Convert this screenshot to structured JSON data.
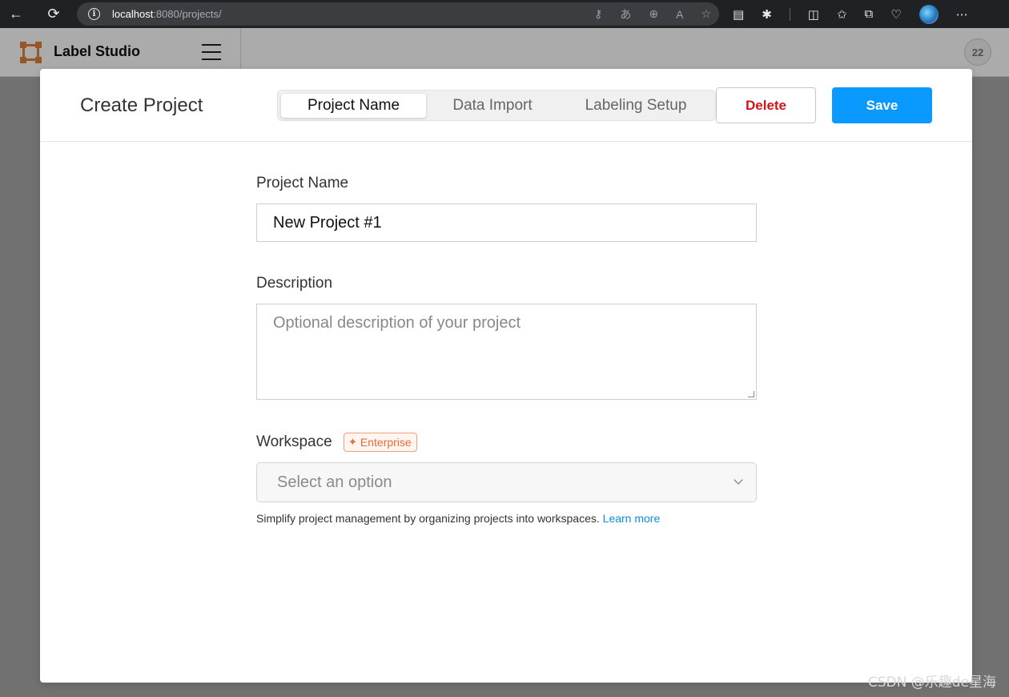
{
  "browser": {
    "url_host": "localhost",
    "url_path": ":8080/projects/",
    "icons": [
      "back-icon",
      "refresh-icon",
      "info-icon",
      "key-icon",
      "translate-icon",
      "zoom-icon",
      "read-aloud-icon",
      "favorite-icon",
      "reading-view-icon",
      "extensions-icon",
      "split-screen-icon",
      "favorites-icon",
      "collections-icon",
      "health-icon",
      "profile-avatar",
      "more-icon"
    ]
  },
  "app": {
    "title": "Label Studio",
    "user_initials": "22"
  },
  "modal": {
    "title": "Create Project",
    "tabs": [
      {
        "label": "Project Name",
        "active": true
      },
      {
        "label": "Data Import",
        "active": false
      },
      {
        "label": "Labeling Setup",
        "active": false
      }
    ],
    "delete_label": "Delete",
    "save_label": "Save",
    "project_name": {
      "label": "Project Name",
      "value": "New Project #1"
    },
    "description": {
      "label": "Description",
      "placeholder": "Optional description of your project"
    },
    "workspace": {
      "label": "Workspace",
      "badge": "Enterprise",
      "placeholder": "Select an option",
      "help_text": "Simplify project management by organizing projects into workspaces.",
      "learn_more": "Learn more"
    }
  },
  "watermark": "CSDN @乐趣de星海",
  "colors": {
    "save_button": "#0a99ff",
    "delete_text": "#d0141a",
    "logo": "#e0803a",
    "enterprise": "#e96a3c",
    "link": "#0a8ee8"
  }
}
